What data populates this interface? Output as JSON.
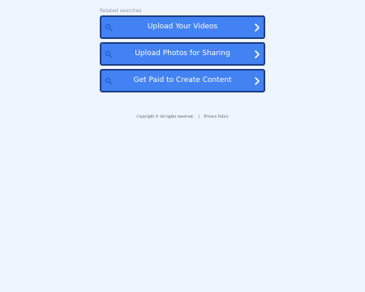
{
  "related": {
    "title": "Related searches",
    "items": [
      {
        "label": "Upload Your Videos",
        "icon": "search-icon",
        "action_icon": "chevron-right-icon"
      },
      {
        "label": "Upload Photos for Sharing",
        "icon": "search-icon",
        "action_icon": "chevron-right-icon"
      },
      {
        "label": "Get Paid to Create Content",
        "icon": "search-icon",
        "action_icon": "chevron-right-icon"
      }
    ]
  },
  "footer": {
    "copyright": "Copyright © All rights reserved.",
    "separator": "|",
    "privacy_policy": "Privacy Policy"
  },
  "colors": {
    "background": "#eef5ff",
    "button_fill": "#4282f2",
    "button_border": "#1d3d86",
    "icon": "#1f5fd1",
    "text": "#ffffff",
    "muted_text": "#8f99a8"
  }
}
